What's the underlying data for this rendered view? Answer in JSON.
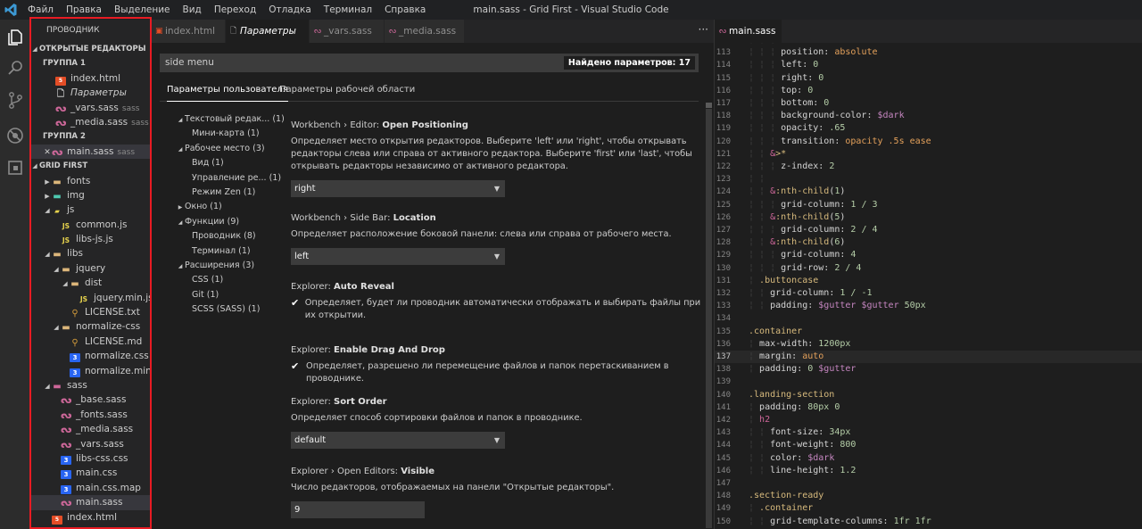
{
  "titlebar": {
    "menu": [
      "Файл",
      "Правка",
      "Выделение",
      "Вид",
      "Переход",
      "Отладка",
      "Терминал",
      "Справка"
    ],
    "window_title": "main.sass - Grid First - Visual Studio Code"
  },
  "activity_bar": {
    "icons": [
      "explorer-icon",
      "search-icon",
      "source-control-icon",
      "debug-icon",
      "extensions-icon"
    ]
  },
  "explorer": {
    "title": "ПРОВОДНИК",
    "open_editors_header": "ОТКРЫТЫЕ РЕДАКТОРЫ",
    "group1_header": "ГРУППА 1",
    "group1": [
      {
        "name": "index.html",
        "sub": ""
      },
      {
        "name": "Параметры",
        "sub": ""
      },
      {
        "name": "_vars.sass",
        "sub": "sass"
      },
      {
        "name": "_media.sass",
        "sub": "sass"
      }
    ],
    "group2_header": "ГРУППА 2",
    "group2": [
      {
        "name": "main.sass",
        "sub": "sass",
        "close": "✕"
      }
    ],
    "project_header": "GRID FIRST",
    "tree": [
      "fonts",
      "img",
      "js",
      "common.js",
      "libs-js.js",
      "libs",
      "jquery",
      "dist",
      "jquery.min.js",
      "LICENSE.txt",
      "normalize-css",
      "LICENSE.md",
      "normalize.css",
      "normalize.min....",
      "sass",
      "_base.sass",
      "_fonts.sass",
      "_media.sass",
      "_vars.sass",
      "libs-css.css",
      "main.css",
      "main.css.map",
      "main.sass",
      "index.html"
    ]
  },
  "editor1": {
    "tabs": [
      "index.html",
      "Параметры",
      "_vars.sass",
      "_media.sass"
    ],
    "more": "···"
  },
  "settings": {
    "search_value": "side menu",
    "search_count": "Найдено параметров: 17",
    "tab_user": "Параметры пользователя",
    "tab_workspace": "Параметры рабочей области",
    "toc": [
      {
        "label": "Текстовый редак...",
        "count": "(1)"
      },
      {
        "label": "Мини-карта",
        "count": "(1)"
      },
      {
        "label": "Рабочее место",
        "count": "(3)"
      },
      {
        "label": "Вид",
        "count": "(1)"
      },
      {
        "label": "Управление ре...",
        "count": "(1)"
      },
      {
        "label": "Режим Zen",
        "count": "(1)"
      },
      {
        "label": "Окно",
        "count": "(1)"
      },
      {
        "label": "Функции",
        "count": "(9)"
      },
      {
        "label": "Проводник",
        "count": "(8)"
      },
      {
        "label": "Терминал",
        "count": "(1)"
      },
      {
        "label": "Расширения",
        "count": "(3)"
      },
      {
        "label": "CSS",
        "count": "(1)"
      },
      {
        "label": "Git",
        "count": "(1)"
      },
      {
        "label": "SCSS (SASS)",
        "count": "(1)"
      }
    ],
    "items": [
      {
        "category": "Workbench › Editor: ",
        "name": "Open Positioning",
        "desc": "Определяет место открытия редакторов. Выберите 'left' или 'right', чтобы открывать редакторы слева или справа от активного редактора. Выберите 'first' или 'last', чтобы открывать редакторы независимо от активного редактора.",
        "value": "right",
        "caret": "▼"
      },
      {
        "category": "Workbench › Side Bar: ",
        "name": "Location",
        "desc": "Определяет расположение боковой панели: слева или справа от рабочего места.",
        "value": "left",
        "caret": "▼"
      },
      {
        "category": "Explorer: ",
        "name": "Auto Reveal",
        "check": "✔",
        "desc": "Определяет, будет ли проводник автоматически отображать и выбирать файлы при их открытии."
      },
      {
        "category": "Explorer: ",
        "name": "Enable Drag And Drop",
        "check": "✔",
        "desc": "Определяет, разрешено ли перемещение файлов и папок перетаскиванием в проводнике."
      },
      {
        "category": "Explorer: ",
        "name": "Sort Order",
        "desc": "Определяет способ сортировки файлов и папок в проводнике.",
        "value": "default",
        "caret": "▼"
      },
      {
        "category": "Explorer › Open Editors: ",
        "name": "Visible",
        "desc": "Число редакторов, отображаемых на панели \"Открытые редакторы\".",
        "value": "9"
      }
    ]
  },
  "editor2": {
    "tab": "main.sass",
    "line_numbers": [
      "113",
      "114",
      "115",
      "116",
      "117",
      "118",
      "119",
      "120",
      "121",
      "122",
      "123",
      "124",
      "125",
      "126",
      "127",
      "128",
      "129",
      "130",
      "131",
      "132",
      "133",
      "134",
      "135",
      "136",
      "137",
      "138",
      "139",
      "140",
      "141",
      "142",
      "143",
      "144",
      "145",
      "146",
      "147",
      "148",
      "149",
      "150"
    ],
    "current_line": "137"
  }
}
